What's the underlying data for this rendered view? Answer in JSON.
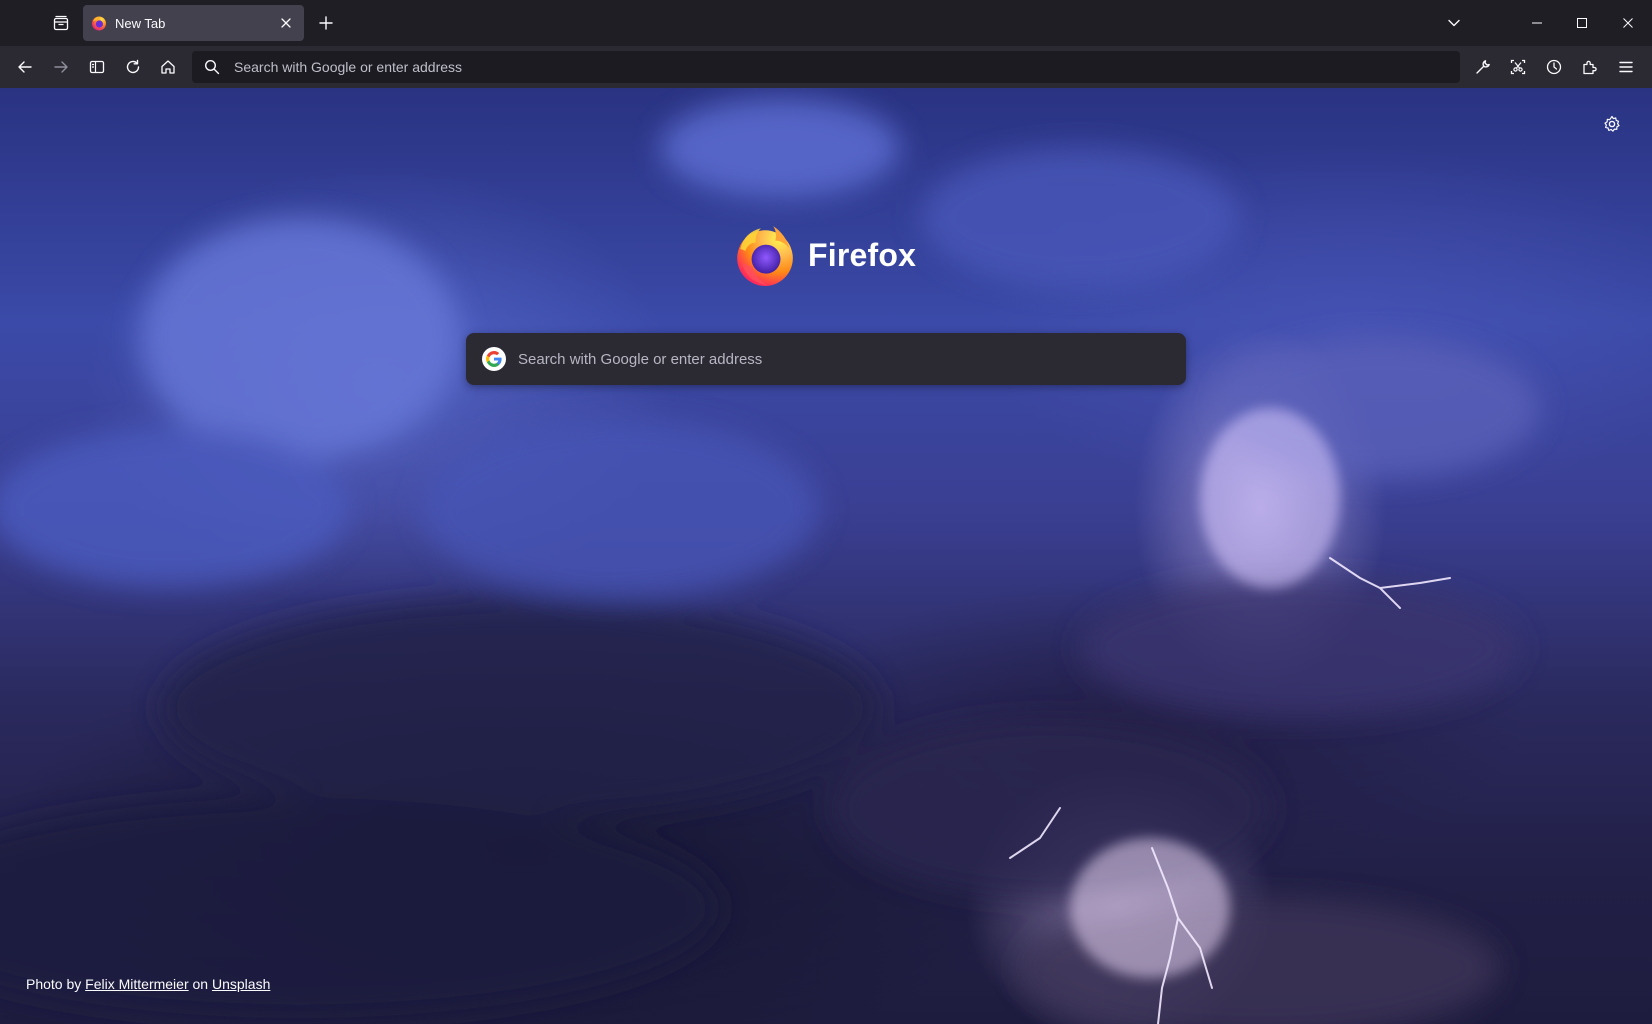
{
  "tabstrip": {
    "tabs": [
      {
        "title": "New Tab",
        "active": true
      }
    ]
  },
  "navbar": {
    "url_placeholder": "Search with Google or enter address"
  },
  "content": {
    "wordmark": "Firefox",
    "search_placeholder": "Search with Google or enter address",
    "attribution": {
      "prefix": "Photo by",
      "photographer": "Felix Mittermeier",
      "middle": "on",
      "source": "Unsplash"
    }
  },
  "icons": {
    "tab_overview": "firefox-view-icon",
    "favicon": "firefox-logo-icon",
    "tab_close": "close-icon",
    "new_tab": "plus-icon",
    "list_tabs": "chevron-down-icon",
    "back": "back-arrow-icon",
    "forward": "forward-arrow-icon",
    "sidebar": "sidebar-icon",
    "reload": "reload-icon",
    "home": "home-icon",
    "search": "search-icon",
    "tools": "wrench-icon",
    "screenshot": "screenshot-icon",
    "history": "history-clock-icon",
    "extensions": "puzzle-icon",
    "menu": "hamburger-menu-icon",
    "settings": "gear-icon",
    "google": "google-g-icon"
  },
  "colors": {
    "tabstrip_bg": "#1f1e25",
    "active_tab_bg": "#42414d",
    "navbar_bg": "#2b2a33",
    "urlbar_bg": "#1c1b22",
    "search_box_bg": "#2b2a33",
    "text": "#fbfbfe"
  }
}
